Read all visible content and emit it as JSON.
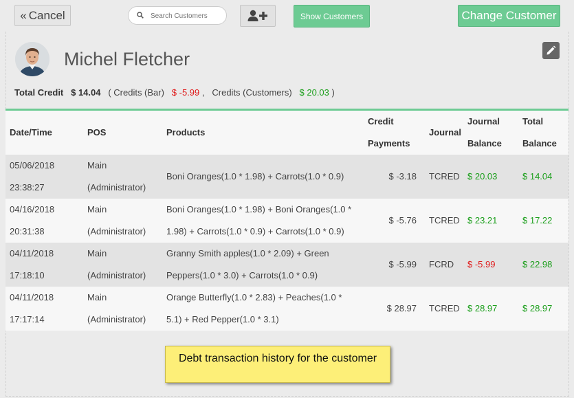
{
  "toolbar": {
    "cancel_label": "Cancel",
    "cancel_icon": "double-chevron-left-icon",
    "search_placeholder": "Search Customers",
    "add_user_icon": "user-plus-icon",
    "show_customers_label": "Show Customers",
    "change_customer_label": "Change Customer"
  },
  "customer": {
    "name": "Michel Fletcher",
    "avatar_icon": "customer-avatar"
  },
  "credits": {
    "total_label": "Total Credit",
    "total_value": "$ 14.04",
    "bar_label": "( Credits (Bar)",
    "bar_value": "$ -5.99",
    "separator": ",",
    "customers_label": "Credits (Customers)",
    "customers_value": "$ 20.03",
    "close": ")"
  },
  "table": {
    "headers": {
      "datetime": "Date/Time",
      "pos": "POS",
      "products": "Products",
      "credit_payments_1": "Credit",
      "credit_payments_2": "Payments",
      "journal": "Journal",
      "journal_balance_1": "Journal",
      "journal_balance_2": "Balance",
      "total_balance_1": "Total",
      "total_balance_2": "Balance"
    },
    "rows": [
      {
        "date": "05/06/2018",
        "time": "23:38:27",
        "pos1": "Main",
        "pos2": "(Administrator)",
        "products": "Boni Oranges(1.0 * 1.98) + Carrots(1.0 * 0.9)",
        "credit_payment": "$ -3.18",
        "journal": "TCRED",
        "journal_balance": "$ 20.03",
        "total_balance": "$ 14.04"
      },
      {
        "date": "04/16/2018",
        "time": "20:31:38",
        "pos1": "Main",
        "pos2": "(Administrator)",
        "products": "Boni Oranges(1.0 * 1.98) + Boni Oranges(1.0 * 1.98) + Carrots(1.0 * 0.9) + Carrots(1.0 * 0.9)",
        "credit_payment": "$ -5.76",
        "journal": "TCRED",
        "journal_balance": "$ 23.21",
        "total_balance": "$ 17.22"
      },
      {
        "date": "04/11/2018",
        "time": "17:18:10",
        "pos1": "Main",
        "pos2": "(Administrator)",
        "products": "Granny Smith apples(1.0 * 2.09) + Green Peppers(1.0 * 3.0) + Carrots(1.0 * 0.9)",
        "credit_payment": "$ -5.99",
        "journal": "FCRD",
        "journal_balance": "$ -5.99",
        "total_balance": "$ 22.98"
      },
      {
        "date": "04/11/2018",
        "time": "17:17:14",
        "pos1": "Main",
        "pos2": "(Administrator)",
        "products": "Orange Butterfly(1.0 * 2.83) + Peaches(1.0 * 5.1) + Red Pepper(1.0 * 3.1)",
        "credit_payment": "$ 28.97",
        "journal": "TCRED",
        "journal_balance": "$ 28.97",
        "total_balance": "$ 28.97"
      }
    ]
  },
  "note": {
    "text": "Debt transaction history for the customer"
  },
  "colors": {
    "accent": "#6dcb93",
    "positive": "#1a9e1a",
    "negative": "#e01b1b",
    "note_bg": "#fdef78"
  }
}
